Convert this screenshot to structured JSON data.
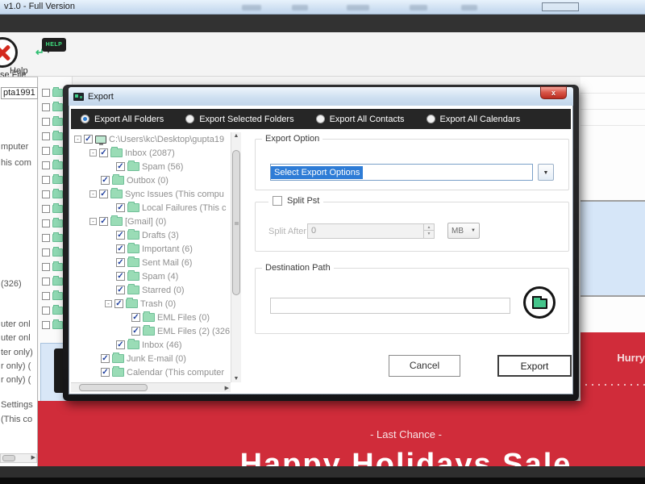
{
  "app": {
    "title": "v1.0 - Full Version",
    "close_file_label": "se File",
    "help_label": "Help",
    "help_bubble_text": "HELP"
  },
  "sidebar": {
    "items": [
      "pta1991",
      "mputer",
      "his com",
      "(326)",
      "uter onl",
      "uter onl",
      "ter only)",
      "r only) (",
      "r only) (",
      "Settings",
      "(This co"
    ]
  },
  "banner": {
    "hurry_text": "Hurry",
    "last_chance_text": "- Last Chance -",
    "headline_text": "Happy Holidays Sale",
    "red_color": "#d02c3a"
  },
  "dialog": {
    "title": "Export",
    "close_glyph": "x",
    "radios": [
      {
        "label": "Export All Folders",
        "selected": true
      },
      {
        "label": "Export Selected Folders",
        "selected": false
      },
      {
        "label": "Export All Contacts",
        "selected": false
      },
      {
        "label": "Export All Calendars",
        "selected": false
      }
    ],
    "tree": [
      {
        "label": "C:\\Users\\kc\\Desktop\\gupta19",
        "level": 0,
        "parent": true,
        "icon": "computer"
      },
      {
        "label": "Inbox (2087)",
        "level": 1,
        "parent": true
      },
      {
        "label": "Spam (56)",
        "level": 2
      },
      {
        "label": "Outbox (0)",
        "level": 1
      },
      {
        "label": "Sync Issues (This compu",
        "level": 1,
        "parent": true
      },
      {
        "label": "Local Failures (This c",
        "level": 2
      },
      {
        "label": "[Gmail] (0)",
        "level": 1,
        "parent": true
      },
      {
        "label": "Drafts (3)",
        "level": 2
      },
      {
        "label": "Important (6)",
        "level": 2
      },
      {
        "label": "Sent Mail (6)",
        "level": 2
      },
      {
        "label": "Spam (4)",
        "level": 2
      },
      {
        "label": "Starred (0)",
        "level": 2
      },
      {
        "label": "Trash (0)",
        "level": 2,
        "parent": true
      },
      {
        "label": "EML Files (0)",
        "level": 3
      },
      {
        "label": "EML Files (2) (326",
        "level": 3
      },
      {
        "label": "Inbox (46)",
        "level": 2
      },
      {
        "label": "Junk E-mail (0)",
        "level": 1
      },
      {
        "label": "Calendar (This computer",
        "level": 1
      }
    ],
    "export_option": {
      "group_label": "Export Option",
      "combo_value": "Select Export Options"
    },
    "split": {
      "group_label": "Split Pst",
      "after_label": "Split After",
      "value": "0",
      "unit": "MB"
    },
    "destination": {
      "group_label": "Destination Path",
      "value": ""
    },
    "buttons": {
      "cancel_label": "Cancel",
      "export_label": "Export"
    }
  }
}
